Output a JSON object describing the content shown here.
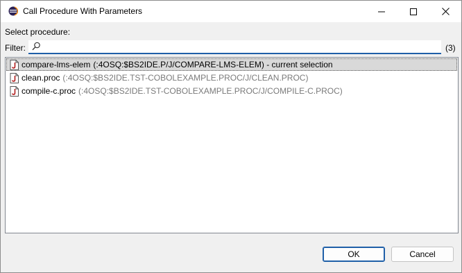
{
  "window": {
    "title": "Call Procedure With Parameters"
  },
  "dialog": {
    "select_label": "Select procedure:",
    "filter_label": "Filter:",
    "filter_value": "",
    "filter_placeholder": "",
    "result_count": "(3)"
  },
  "procedures": [
    {
      "name": "compare-lms-elem",
      "qualifier": "(:4OSQ:$BS2IDE.P/J/COMPARE-LMS-ELEM) - current selection",
      "selected": true
    },
    {
      "name": "clean.proc",
      "qualifier": "(:4OSQ:$BS2IDE.TST-COBOLEXAMPLE.PROC/J/CLEAN.PROC)",
      "selected": false
    },
    {
      "name": "compile-c.proc",
      "qualifier": "(:4OSQ:$BS2IDE.TST-COBOLEXAMPLE.PROC/J/COMPILE-C.PROC)",
      "selected": false
    }
  ],
  "buttons": {
    "ok_label": "OK",
    "cancel_label": "Cancel"
  },
  "icons": {
    "app": "eclipse-icon",
    "search": "search-icon",
    "procedure": "procedure-file-icon",
    "minimize": "minimize-icon",
    "maximize": "maximize-icon",
    "close": "close-icon"
  },
  "colors": {
    "accent": "#1f5fa8",
    "selection": "#d9d9d9",
    "qualifier_text": "#7a7a7a",
    "file_icon": "#b01c1c"
  }
}
